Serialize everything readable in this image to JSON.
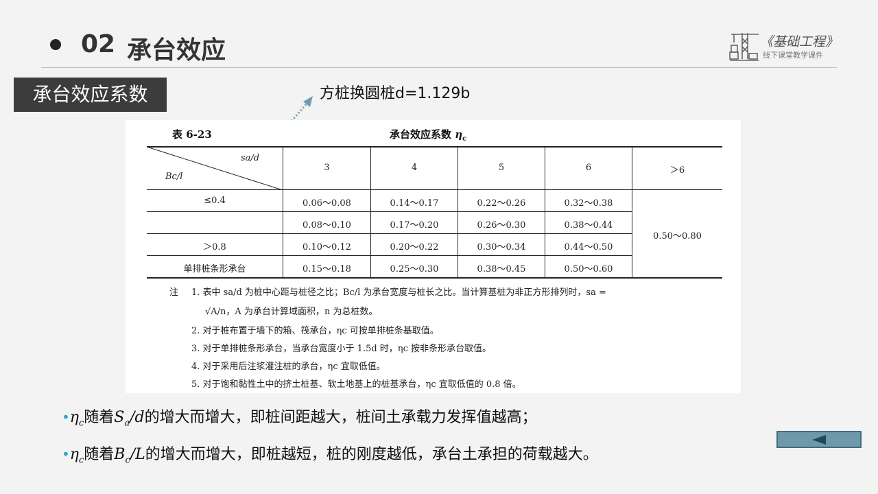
{
  "header": {
    "number": "02",
    "title": "承台效应"
  },
  "logo": {
    "title": "《基础工程》",
    "subtitle": "线下课堂教学课件"
  },
  "section_label": "承台效应系数",
  "annotation": "方桩换圆桩d=1.129b",
  "table": {
    "number": "表 6-23",
    "title": "承台效应系数",
    "title_symbol": "η",
    "title_sub": "c",
    "corner_top": "sa/d",
    "corner_bottom": "Bc/l",
    "columns": [
      "3",
      "4",
      "5",
      "6",
      "＞6"
    ],
    "rows": [
      {
        "label": "≤0.4",
        "values": [
          "0.06～0.08",
          "0.14～0.17",
          "0.22～0.26",
          "0.32～0.38"
        ]
      },
      {
        "label": "",
        "values": [
          "0.08～0.10",
          "0.17～0.20",
          "0.26～0.30",
          "0.38～0.44"
        ]
      },
      {
        "label": "＞0.8",
        "values": [
          "0.10～0.12",
          "0.20～0.22",
          "0.30～0.34",
          "0.44～0.50"
        ]
      },
      {
        "label": "单排桩条形承台",
        "values": [
          "0.15～0.18",
          "0.25～0.30",
          "0.38～0.45",
          "0.50～0.60"
        ]
      }
    ],
    "merged_value": "0.50～0.80",
    "notes_label": "注",
    "notes": [
      "1. 表中 sa/d 为桩中心距与桩径之比；Bc/l 为承台宽度与桩长之比。当计算基桩为非正方形排列时，sa =",
      "√A/n，A 为承台计算域面积，n 为总桩数。",
      "2. 对于桩布置于墙下的箱、筏承台，ηc 可按单排桩条基取值。",
      "3. 对于单排桩条形承台，当承台宽度小于 1.5d 时，ηc 按非条形承台取值。",
      "4. 对于采用后注浆灌注桩的承台，ηc 宜取低值。",
      "5. 对于饱和黏性土中的挤土桩基、软土地基上的桩基承台，ηc 宜取低值的 0.8 倍。"
    ]
  },
  "bullets": [
    {
      "sym": "η",
      "sym_sub": "c",
      "mid1": "随着",
      "var": "S",
      "var_sub": "a",
      "var_tail": "/d",
      "text": "的增大而增大，即桩间距越大，桩间土承载力发挥值越高；"
    },
    {
      "sym": "η",
      "sym_sub": "c",
      "mid1": "随着",
      "var": "B",
      "var_sub": "c",
      "var_tail": "/L",
      "text": "的增大而增大，即桩越短，桩的刚度越低，承台土承担的荷载越大。"
    }
  ],
  "colors": {
    "accent": "#2aa9c9",
    "button": "#6f98aa",
    "arrow": "#6e9db0"
  },
  "icons": {
    "logo": "crane-icon",
    "back": "triangle-left-icon"
  }
}
